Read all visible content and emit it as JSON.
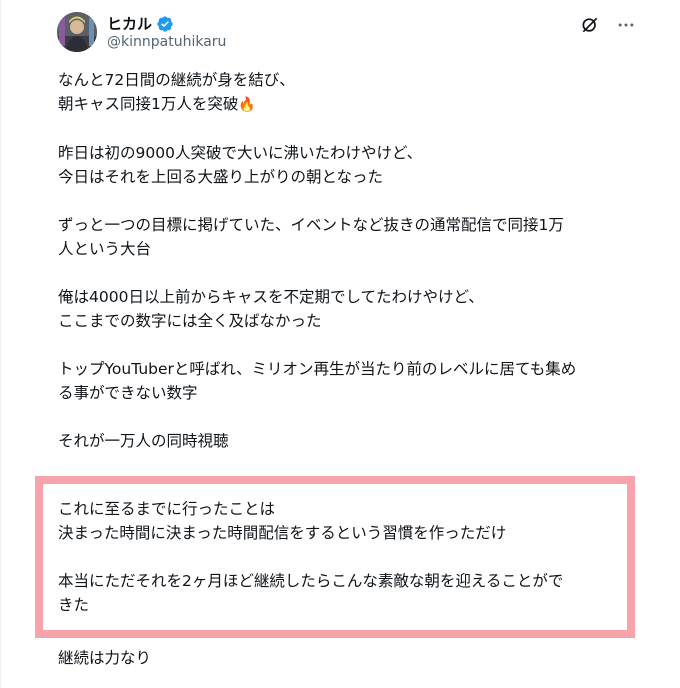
{
  "post": {
    "author_name": "ヒカル",
    "author_handle": "@kinnpatuhikaru",
    "paragraphs": [
      [
        "なんと72日間の継続が身を結び、",
        "朝キャス同接1万人を突破"
      ],
      [
        "昨日は初の9000人突破で大いに沸いたわけやけど、",
        "今日はそれを上回る大盛り上がりの朝となった"
      ],
      [
        "ずっと一つの目標に掲げていた、イベントなど抜きの通常配信で同接1万",
        "人という大台"
      ],
      [
        "俺は4000日以上前からキャスを不定期でしてたわけやけど、",
        "ここまでの数字には全く及ばなかった"
      ],
      [
        "トップYouTuberと呼ばれ、ミリオン再生が当たり前のレベルに居ても集め",
        "る事ができない数字"
      ],
      [
        "それが一万人の同時視聴"
      ]
    ],
    "highlighted": [
      [
        "これに至るまでに行ったことは",
        "決まった時間に決まった時間配信をするという習慣を作っただけ"
      ],
      [
        "本当にただそれを2ヶ月ほど継続したらこんな素敵な朝を迎えることがで",
        "きた"
      ]
    ],
    "closing": "継続は力なり",
    "emoji": "🔥"
  },
  "colors": {
    "verified_badge": "#1d9bf0",
    "highlight_border": "#f6a3ab",
    "handle_text": "#536471"
  },
  "icons": [
    "verified-badge-icon",
    "grok-icon",
    "more-icon"
  ]
}
